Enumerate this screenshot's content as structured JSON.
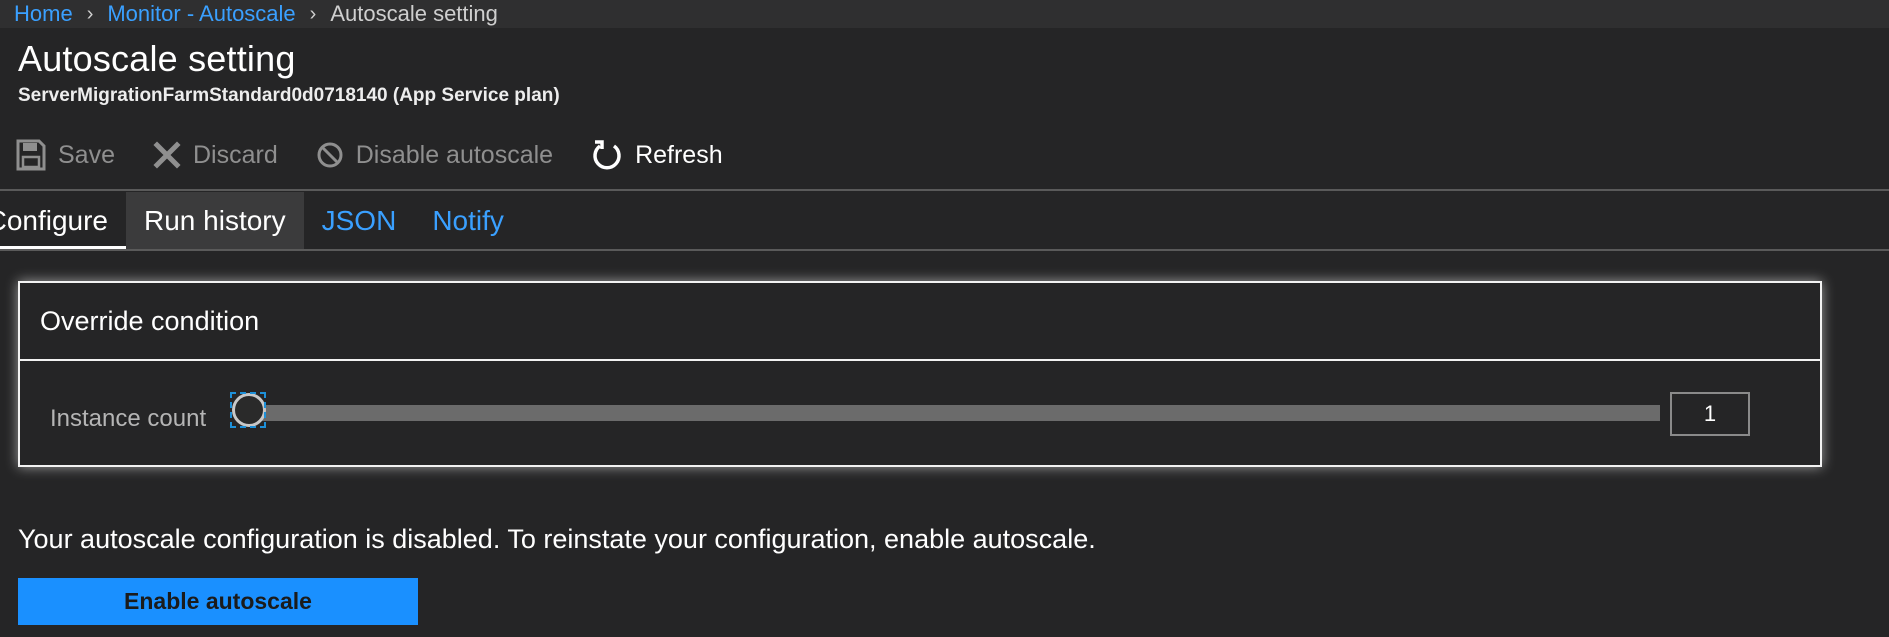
{
  "breadcrumb": {
    "items": [
      {
        "label": "Home"
      },
      {
        "label": "Monitor - Autoscale"
      },
      {
        "label": "Autoscale setting"
      }
    ]
  },
  "header": {
    "title": "Autoscale setting",
    "subtitle": "ServerMigrationFarmStandard0d0718140 (App Service plan)"
  },
  "toolbar": {
    "save_label": "Save",
    "discard_label": "Discard",
    "disable_label": "Disable autoscale",
    "refresh_label": "Refresh"
  },
  "tabs": [
    {
      "label": "Configure",
      "state": "selected"
    },
    {
      "label": "Run history",
      "state": "hover"
    },
    {
      "label": "JSON",
      "state": "link"
    },
    {
      "label": "Notify",
      "state": "link"
    }
  ],
  "override_panel": {
    "title": "Override condition",
    "instance_count_label": "Instance count",
    "instance_count_value": "1",
    "slider_level": 0
  },
  "message": "Your autoscale configuration is disabled. To reinstate your configuration, enable autoscale.",
  "enable_button_label": "Enable autoscale",
  "colors": {
    "background": "#252526",
    "accent": "#1a90ff",
    "link": "#3aa0ff",
    "disabled_text": "#8f8f8f"
  }
}
